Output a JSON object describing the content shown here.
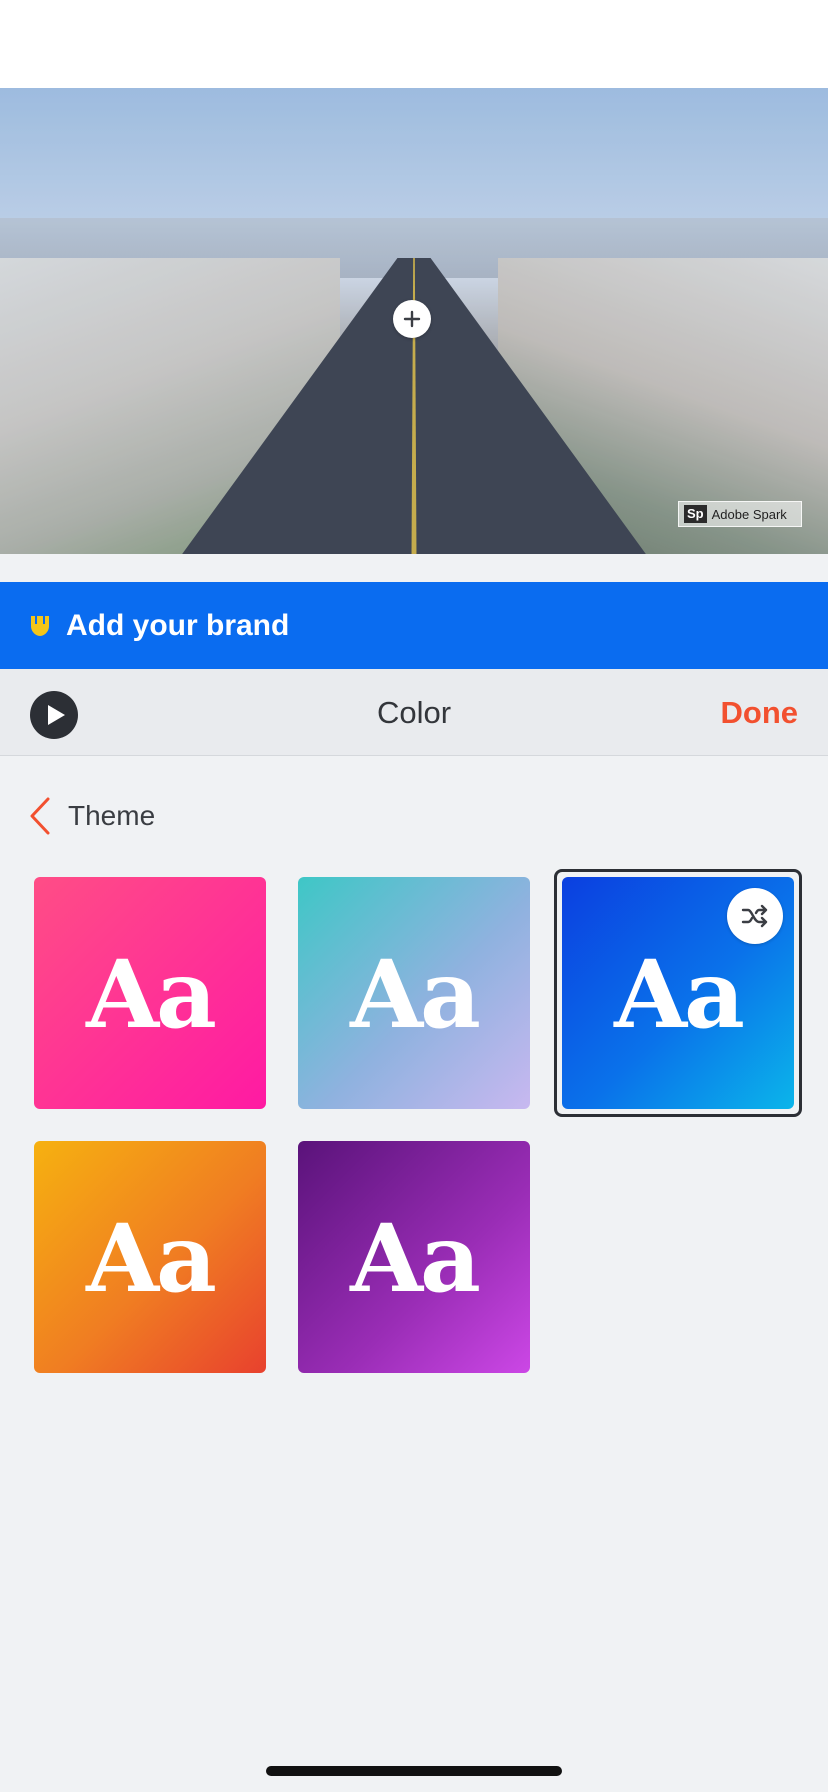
{
  "preview": {
    "watermark_badge": "Sp",
    "watermark_text": "Adobe Spark",
    "add_media_icon": "plus-icon"
  },
  "brand_banner": {
    "label": "Add your brand",
    "icon": "shield-icon",
    "icon_color": "#f5c518",
    "background": "#0a6cf0"
  },
  "toolbar": {
    "title": "Color",
    "done_label": "Done",
    "done_color": "#f2502f",
    "play_icon": "play-icon"
  },
  "theme": {
    "back_label": "Theme",
    "back_icon": "chevron-left-icon",
    "swatches": [
      {
        "label": "Aa",
        "name": "pink",
        "selected": false
      },
      {
        "label": "Aa",
        "name": "teal",
        "selected": false
      },
      {
        "label": "Aa",
        "name": "blue",
        "selected": true,
        "shuffle_icon": "shuffle-icon"
      },
      {
        "label": "Aa",
        "name": "orange",
        "selected": false
      },
      {
        "label": "Aa",
        "name": "purple",
        "selected": false
      }
    ]
  }
}
